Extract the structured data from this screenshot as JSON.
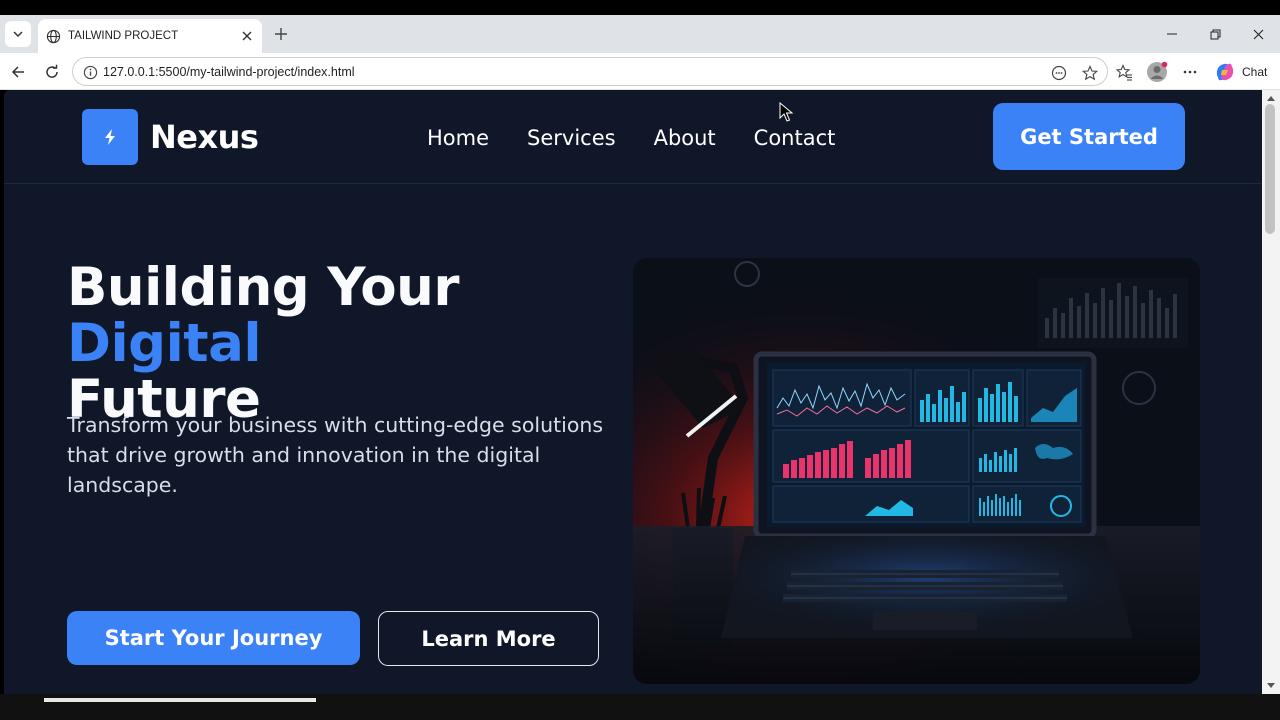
{
  "browser": {
    "tab_title": "TAILWIND PROJECT",
    "url": "127.0.0.1:5500/my-tailwind-project/index.html",
    "chat_label": "Chat",
    "icons": [
      "tab-list-icon",
      "globe-icon",
      "close-icon",
      "plus-icon",
      "minimize-icon",
      "restore-icon",
      "window-close-icon",
      "back-icon",
      "refresh-icon",
      "info-icon",
      "read-aloud-icon",
      "favorite-icon",
      "favorites-icon",
      "profile-icon",
      "more-icon",
      "copilot-icon"
    ]
  },
  "site": {
    "brand": "Nexus",
    "nav": [
      "Home",
      "Services",
      "About",
      "Contact"
    ],
    "cta": "Get Started",
    "hero": {
      "title_part1": "Building Your ",
      "title_accent": "Digital",
      "title_part2": "Future",
      "subtitle": "Transform your business with cutting-edge solutions that drive growth and innovation in the digital landscape.",
      "primary_button": "Start Your Journey",
      "secondary_button": "Learn More"
    }
  },
  "colors": {
    "page_bg": "#0f1729",
    "accent": "#3b82f6",
    "text": "#f8fafc"
  }
}
